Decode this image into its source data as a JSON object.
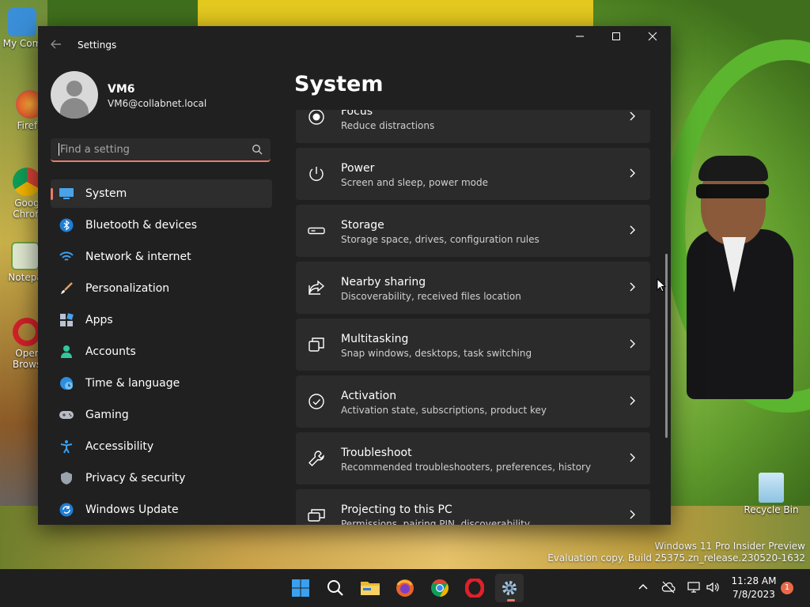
{
  "desktop": {
    "icons": [
      {
        "label": "My Com",
        "color": "#3a8fd8"
      },
      {
        "label": "Firefo",
        "color": "#e8632a"
      },
      {
        "label": "Goog\nChron",
        "color": "#2f9a45"
      },
      {
        "label": "Notepa",
        "color": "#6fa040"
      },
      {
        "label": "Oper\nBrows",
        "color": "#d3202a"
      }
    ],
    "recycle_bin": "Recycle Bin",
    "watermark_line1": "Windows 11 Pro Insider Preview",
    "watermark_line2": "Evaluation copy. Build 25375.zn_release.230520-1632"
  },
  "window": {
    "title": "Settings",
    "profile": {
      "name": "VM6",
      "email": "VM6@collabnet.local"
    },
    "search": {
      "placeholder": "Find a setting"
    },
    "nav": [
      {
        "label": "System",
        "icon": "monitor-icon",
        "active": true
      },
      {
        "label": "Bluetooth & devices",
        "icon": "bluetooth-icon"
      },
      {
        "label": "Network & internet",
        "icon": "wifi-icon"
      },
      {
        "label": "Personalization",
        "icon": "brush-icon"
      },
      {
        "label": "Apps",
        "icon": "apps-icon"
      },
      {
        "label": "Accounts",
        "icon": "person-icon"
      },
      {
        "label": "Time & language",
        "icon": "globe-clock-icon"
      },
      {
        "label": "Gaming",
        "icon": "gamepad-icon"
      },
      {
        "label": "Accessibility",
        "icon": "accessibility-icon"
      },
      {
        "label": "Privacy & security",
        "icon": "shield-icon"
      },
      {
        "label": "Windows Update",
        "icon": "update-icon"
      }
    ],
    "page_title": "System",
    "settings": [
      {
        "title": "Focus",
        "subtitle": "Reduce distractions",
        "icon": "focus-icon"
      },
      {
        "title": "Power",
        "subtitle": "Screen and sleep, power mode",
        "icon": "power-icon"
      },
      {
        "title": "Storage",
        "subtitle": "Storage space, drives, configuration rules",
        "icon": "storage-icon"
      },
      {
        "title": "Nearby sharing",
        "subtitle": "Discoverability, received files location",
        "icon": "share-icon"
      },
      {
        "title": "Multitasking",
        "subtitle": "Snap windows, desktops, task switching",
        "icon": "multitasking-icon"
      },
      {
        "title": "Activation",
        "subtitle": "Activation state, subscriptions, product key",
        "icon": "activation-icon"
      },
      {
        "title": "Troubleshoot",
        "subtitle": "Recommended troubleshooters, preferences, history",
        "icon": "wrench-icon"
      },
      {
        "title": "Projecting to this PC",
        "subtitle": "Permissions, pairing PIN, discoverability",
        "icon": "projector-icon"
      }
    ]
  },
  "taskbar": {
    "time": "11:28 AM",
    "date": "7/8/2023",
    "notifications": "1",
    "accent": "#e87b6a"
  }
}
